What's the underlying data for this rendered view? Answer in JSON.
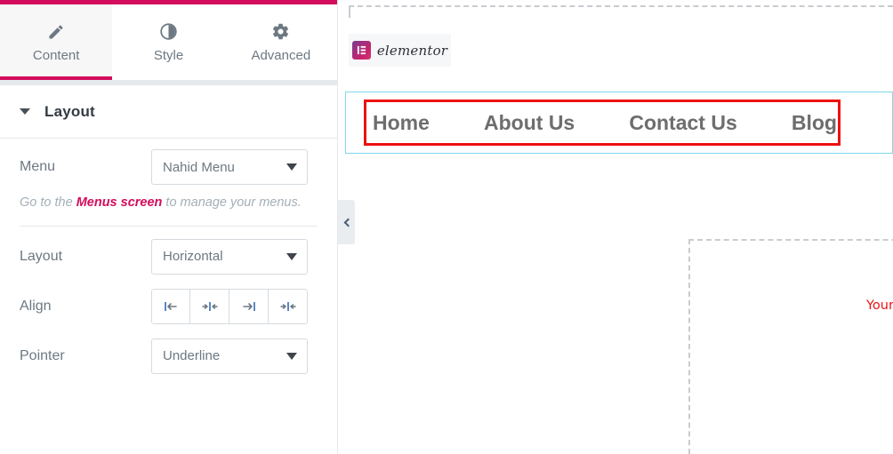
{
  "panel": {
    "accent_color": "#d30c5c",
    "tabs": [
      {
        "label": "Content",
        "icon": "pencil-icon",
        "active": true
      },
      {
        "label": "Style",
        "icon": "contrast-icon",
        "active": false
      },
      {
        "label": "Advanced",
        "icon": "gear-icon",
        "active": false
      }
    ],
    "section": {
      "title": "Layout",
      "expanded": true
    },
    "controls": {
      "menu": {
        "label": "Menu",
        "value": "Nahid Menu",
        "hint_prefix": "Go to the ",
        "hint_link": "Menus screen",
        "hint_suffix": " to manage your menus."
      },
      "layout": {
        "label": "Layout",
        "value": "Horizontal"
      },
      "align": {
        "label": "Align",
        "options": [
          "align-left",
          "align-center",
          "align-right",
          "align-justify"
        ]
      },
      "pointer": {
        "label": "Pointer",
        "value": "Underline"
      }
    }
  },
  "preview": {
    "logo": {
      "text": "elementor",
      "mark": "elementor-logo-icon"
    },
    "menu_items": [
      "Home",
      "About Us",
      "Contact Us",
      "Blog"
    ],
    "annotation": "Your selected menu will appear here like this",
    "annotation_color": "#ee1111",
    "selection_border_color": "#7fd8ea",
    "highlight_box_color": "#ee1111",
    "collapse_handle_icon": "chevron-left-icon"
  }
}
